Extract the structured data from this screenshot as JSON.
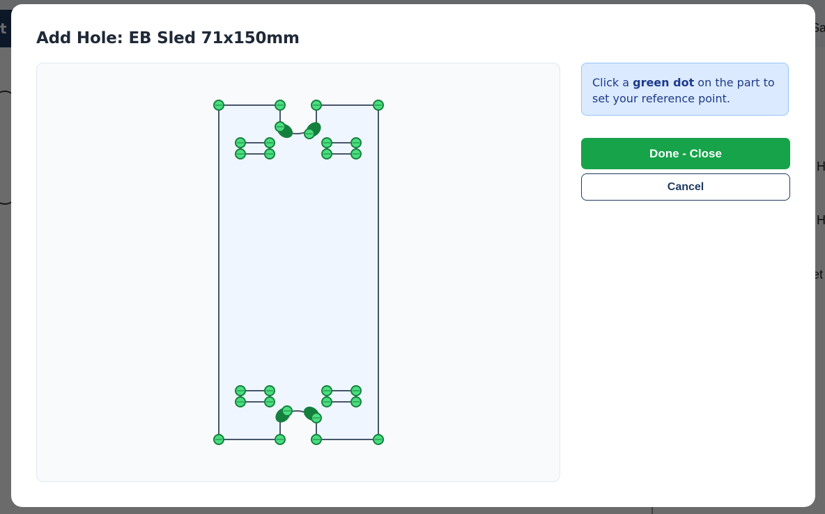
{
  "background": {
    "top_button_fragment": "t",
    "right_fragments": [
      "Sa",
      "H",
      "H",
      "et"
    ]
  },
  "modal": {
    "title": "Add Hole: EB Sled 71x150mm",
    "info": {
      "prefix": "Click a ",
      "emphasis": "green dot",
      "suffix": " on the part to set your reference point."
    },
    "done_label": "Done - Close",
    "cancel_label": "Cancel"
  },
  "colors": {
    "accent_green": "#16a34a",
    "dot_fill": "#4ade80",
    "dot_stroke": "#15803d",
    "outline": "#475569",
    "part_fill": "#eff6ff",
    "info_bg": "#dbeafe",
    "info_text": "#1e3a8a"
  },
  "icons": {
    "reference_point": "green-dot-icon"
  }
}
